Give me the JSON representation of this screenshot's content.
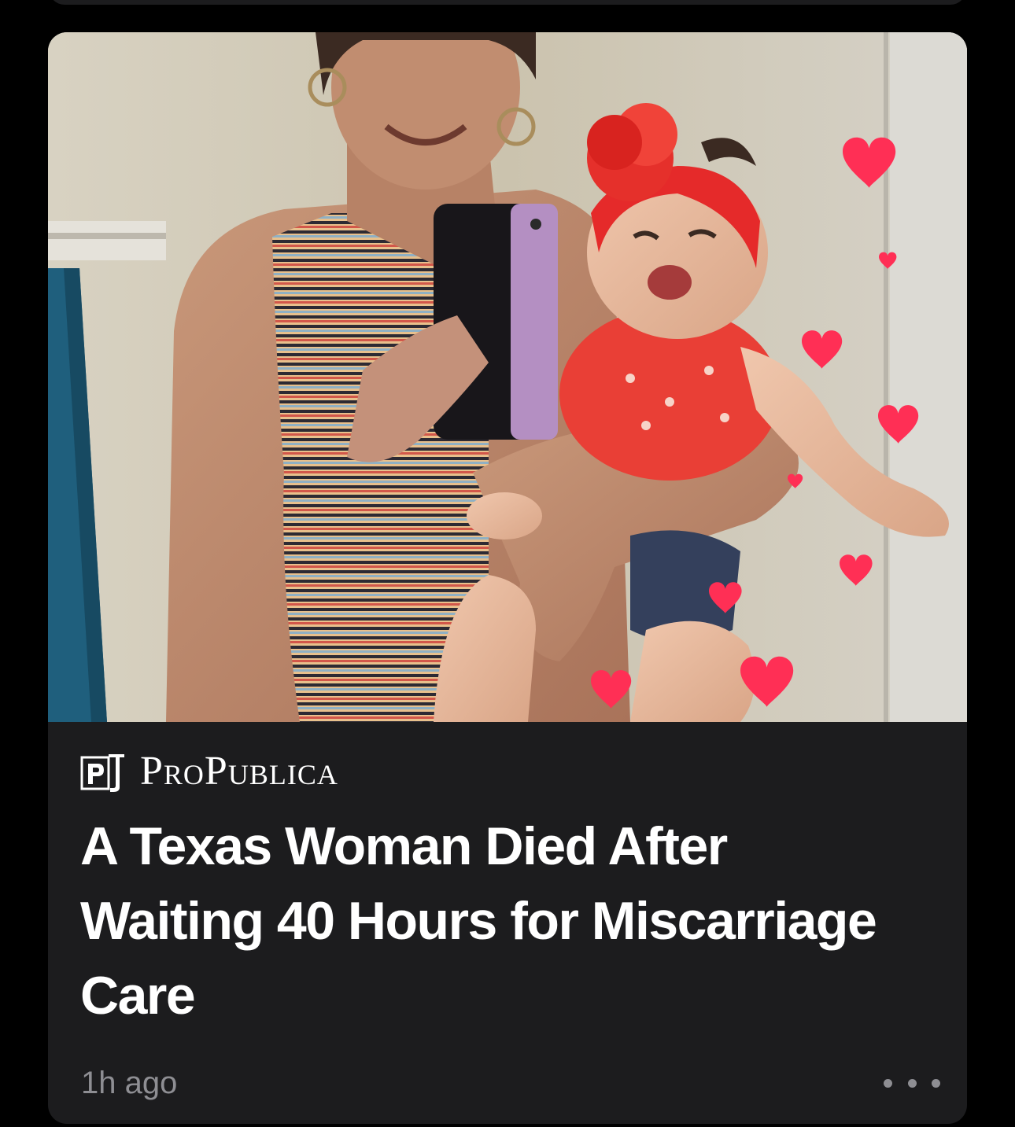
{
  "card": {
    "hero_image": {
      "description": "mirror-selfie-woman-with-baby",
      "icon": "photo"
    },
    "publisher": {
      "logo_text": "P",
      "name": "ProPublica"
    },
    "headline": "A Texas Woman Died After Waiting 40 Hours for Miscarriage Care",
    "timestamp": "1h ago",
    "more_icon": "ellipsis-icon"
  },
  "colors": {
    "background": "#000000",
    "card": "#1c1c1e",
    "headline_text": "#ffffff",
    "meta_text": "#8e8e93",
    "heart": "#ff2f55"
  }
}
